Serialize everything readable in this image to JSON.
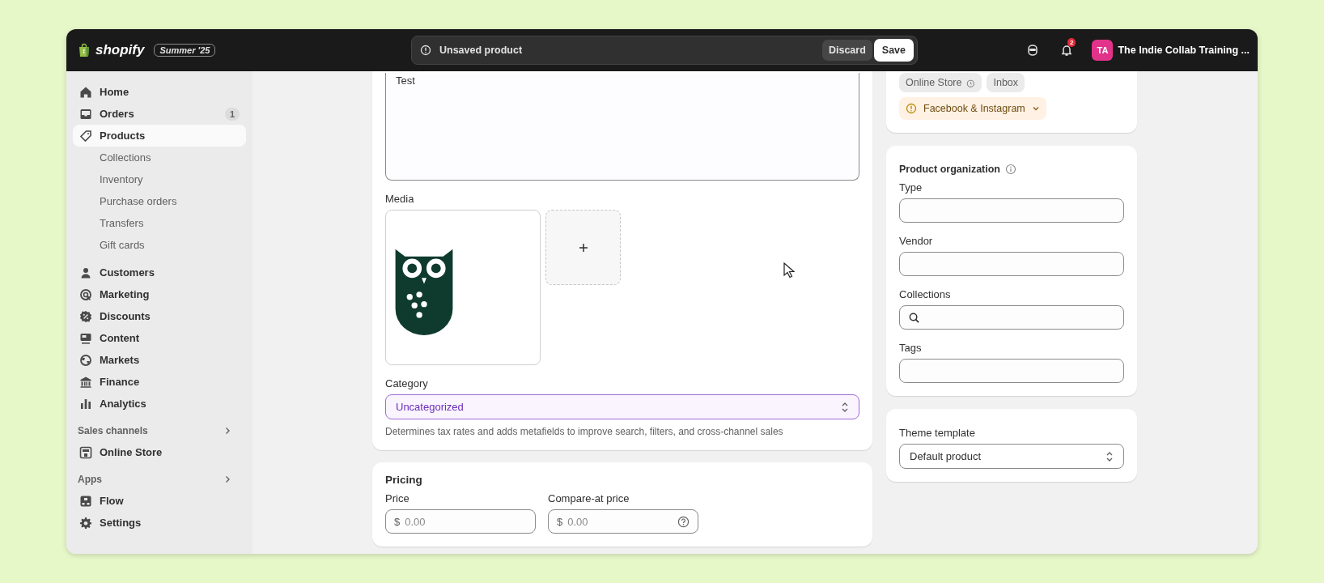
{
  "topbar": {
    "logo_text": "shopify",
    "edition_badge": "Summer '25",
    "notice": "Unsaved product",
    "buttons": [
      {
        "label": "Discard",
        "kind": "secondary"
      },
      {
        "label": "Save",
        "kind": "primary"
      }
    ],
    "notification_count": "2",
    "avatar_initials": "TA",
    "store_name": "The Indie Collab Training ..."
  },
  "sidebar": {
    "groups": [
      {
        "items": [
          {
            "label": "Home",
            "selected": false
          },
          {
            "label": "Orders",
            "selected": false,
            "badge": "1"
          },
          {
            "label": "Products",
            "selected": true,
            "children": [
              {
                "label": "Collections",
                "selected": false
              },
              {
                "label": "Inventory",
                "selected": false
              },
              {
                "label": "Purchase orders",
                "selected": false
              },
              {
                "label": "Transfers",
                "selected": false
              },
              {
                "label": "Gift cards",
                "selected": false
              }
            ]
          }
        ]
      },
      {
        "items": [
          {
            "label": "Customers",
            "selected": false
          },
          {
            "label": "Marketing",
            "selected": false
          },
          {
            "label": "Discounts",
            "selected": false
          },
          {
            "label": "Content",
            "selected": false
          },
          {
            "label": "Markets",
            "selected": false
          },
          {
            "label": "Finance",
            "selected": false
          },
          {
            "label": "Analytics",
            "selected": false
          }
        ]
      },
      {
        "title": "Sales channels",
        "items": [
          {
            "label": "Online Store",
            "selected": false
          }
        ]
      },
      {
        "title": "Apps",
        "items": [
          {
            "label": "Flow",
            "selected": false
          },
          {
            "label": "Settings",
            "selected": false
          }
        ]
      }
    ]
  },
  "main": {
    "description": {
      "value": "Test"
    },
    "media": {
      "label": "Media"
    },
    "category": {
      "label": "Category",
      "value": "Uncategorized",
      "help": "Determines tax rates and adds metafields to improve search, filters, and cross-channel sales"
    },
    "pricing": {
      "title": "Pricing",
      "fields": [
        {
          "label": "Price",
          "currency": "$",
          "placeholder": "0.00",
          "has_help": false
        },
        {
          "label": "Compare-at price",
          "currency": "$",
          "placeholder": "0.00",
          "has_help": true
        }
      ]
    }
  },
  "side": {
    "channels": [
      {
        "label": "Online Store",
        "kind": "scheduled"
      },
      {
        "label": "Inbox",
        "kind": "plain"
      },
      {
        "label": "Facebook & Instagram",
        "kind": "warning"
      }
    ],
    "product_organization": {
      "title": "Product organization",
      "fields": [
        {
          "label": "Type",
          "kind": "text"
        },
        {
          "label": "Vendor",
          "kind": "text"
        },
        {
          "label": "Collections",
          "kind": "search"
        },
        {
          "label": "Tags",
          "kind": "text"
        }
      ]
    },
    "theme_template": {
      "title": "Theme template",
      "value": "Default product"
    }
  }
}
